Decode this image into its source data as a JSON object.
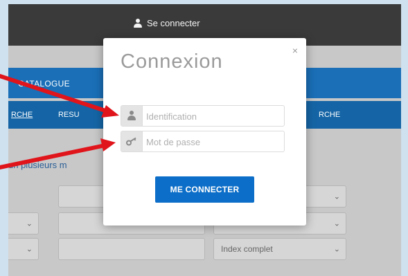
{
  "header": {
    "connect_label": "Se connecter"
  },
  "nav": {
    "catalogue_label": "CATALOGUE"
  },
  "tabs": [
    {
      "label": "RCHE"
    },
    {
      "label": "RESU"
    },
    {
      "label": "RCHE"
    }
  ],
  "search": {
    "help_text": "un plusieurs m",
    "index_select_value": "Index complet"
  },
  "modal": {
    "title": "Connexion",
    "close_glyph": "×",
    "login_placeholder": "Identification",
    "password_placeholder": "Mot de passe",
    "submit_label": "ME CONNECTER"
  },
  "colors": {
    "annotation_arrow": "#e0141b",
    "primary_button": "#0c6ec8",
    "nav_blue": "#1a6fb7"
  }
}
